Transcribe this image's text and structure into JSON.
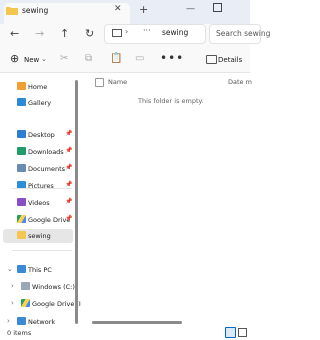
{
  "window": {
    "tab_title": "sewing"
  },
  "address": {
    "path": "sewing",
    "search_placeholder": "Search sewing"
  },
  "toolbar": {
    "new_label": "New",
    "details_label": "Details"
  },
  "sidebar": {
    "items": [
      {
        "label": "Home",
        "icon": "home-icon"
      },
      {
        "label": "Gallery",
        "icon": "gallery-icon"
      },
      {
        "label": "Desktop",
        "icon": "desktop-folder-icon"
      },
      {
        "label": "Downloads",
        "icon": "downloads-folder-icon"
      },
      {
        "label": "Documents",
        "icon": "documents-folder-icon"
      },
      {
        "label": "Pictures",
        "icon": "pictures-folder-icon"
      },
      {
        "label": "Videos",
        "icon": "videos-folder-icon"
      },
      {
        "label": "Google Drive",
        "icon": "google-drive-icon"
      },
      {
        "label": "sewing",
        "icon": "folder-icon"
      },
      {
        "label": "This PC",
        "icon": "pc-icon"
      },
      {
        "label": "Windows (C:)",
        "icon": "drive-icon"
      },
      {
        "label": "Google Drive (I",
        "icon": "google-drive-icon"
      },
      {
        "label": "Network",
        "icon": "network-icon"
      }
    ]
  },
  "content": {
    "columns": {
      "name": "Name",
      "date": "Date m"
    },
    "empty_message": "This folder is empty."
  },
  "status": {
    "item_count": "0 items"
  },
  "colors": {
    "accent": "#0067c0",
    "folder": "#f3c64f",
    "selected": "#e6e6e6",
    "titlebar": "#e9eef6"
  }
}
